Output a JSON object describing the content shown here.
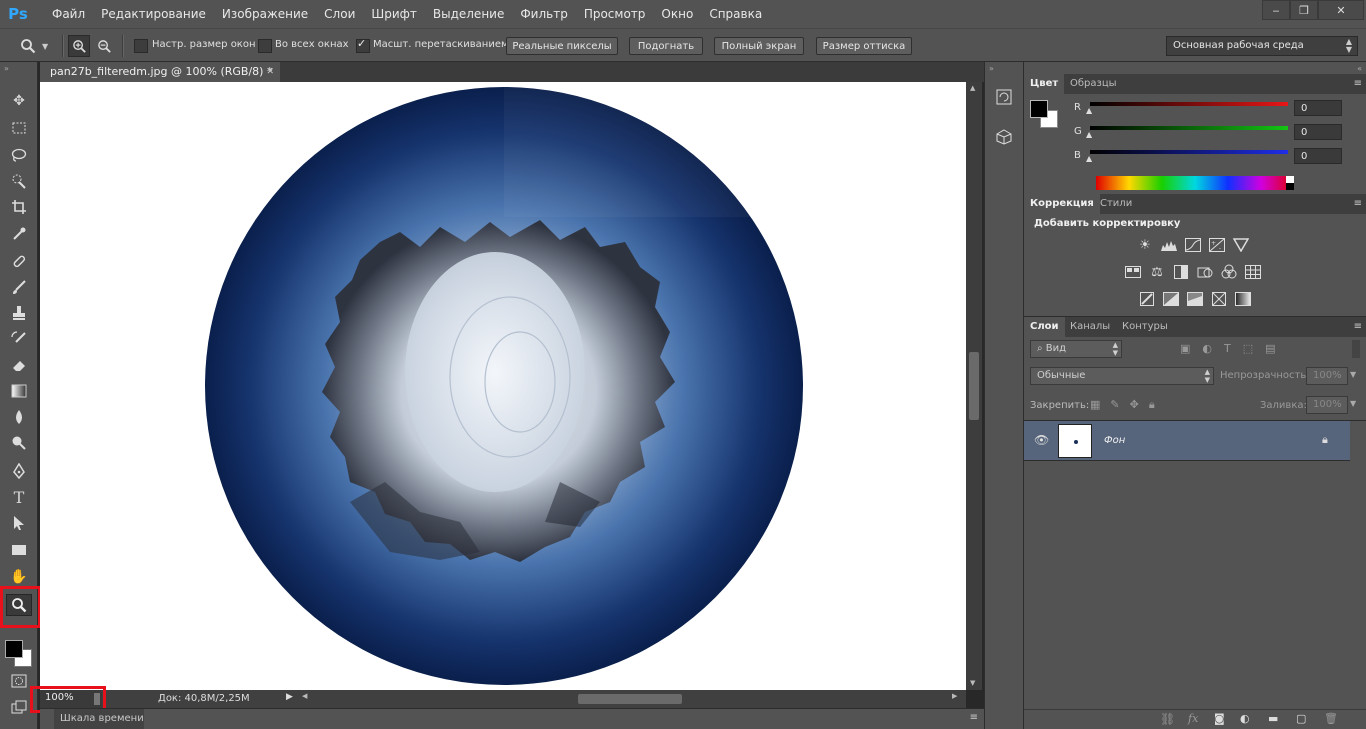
{
  "app": {
    "logo": "Ps"
  },
  "menu": [
    "Файл",
    "Редактирование",
    "Изображение",
    "Слои",
    "Шрифт",
    "Выделение",
    "Фильтр",
    "Просмотр",
    "Окно",
    "Справка"
  ],
  "window_controls": {
    "minimize": "‒",
    "restore": "❐",
    "close": "✕"
  },
  "options": {
    "resize_windows_label": "Настр. размер окон",
    "all_windows_label": "Во всех окнах",
    "scrubby_zoom_label": "Масшт. перетаскиванием",
    "actual_pixels_button": "Реальные пикселы",
    "fit_screen_button": "Подогнать",
    "fill_screen_button": "Полный экран",
    "print_size_button": "Размер оттиска",
    "workspace_select": "Основная рабочая среда"
  },
  "document": {
    "tab_title": "pan27b_filteredm.jpg @ 100% (RGB/8) *",
    "close_glyph": "✕"
  },
  "status": {
    "zoom": "100%",
    "doc_info": "Док: 40,8M/2,25M"
  },
  "timeline": {
    "label": "Шкала времени"
  },
  "color_panel": {
    "tabs": [
      "Цвет",
      "Образцы"
    ],
    "channels": [
      {
        "label": "R",
        "value": "0",
        "color": "#e81616"
      },
      {
        "label": "G",
        "value": "0",
        "color": "#13c413"
      },
      {
        "label": "B",
        "value": "0",
        "color": "#1f2ee8"
      }
    ]
  },
  "adjustments_panel": {
    "tabs": [
      "Коррекция",
      "Стили"
    ],
    "heading": "Добавить корректировку"
  },
  "layers_panel": {
    "tabs": [
      "Слои",
      "Каналы",
      "Контуры"
    ],
    "filter_kind": "Вид",
    "blend_mode": "Обычные",
    "opacity_label": "Непрозрачность:",
    "opacity_value": "100%",
    "lock_label": "Закрепить:",
    "fill_label": "Заливка:",
    "fill_value": "100%",
    "layers": [
      {
        "name": "Фон",
        "locked": true,
        "visible": true
      }
    ]
  },
  "colors": {
    "accent_ps": "#31a8ff",
    "highlight": "#e8111b",
    "planet_outer": "#0a1f4c",
    "planet_inner": "#9fb9da"
  }
}
